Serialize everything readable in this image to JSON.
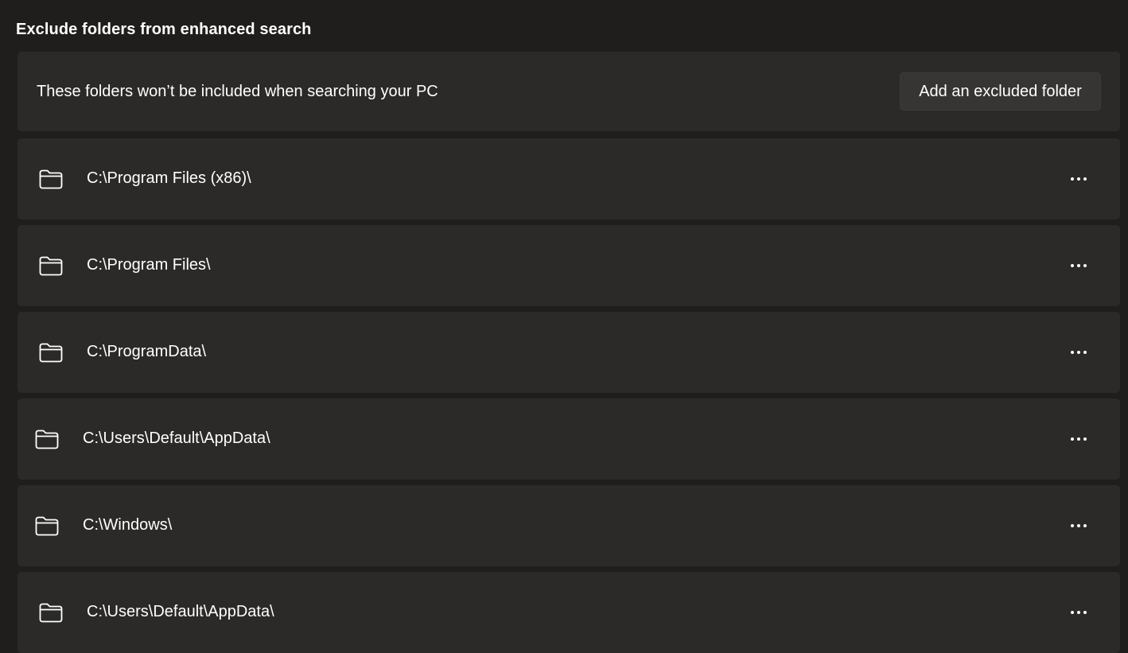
{
  "section": {
    "title": "Exclude folders from enhanced search"
  },
  "header": {
    "description": "These folders won’t be included when searching your PC",
    "add_button_label": "Add an excluded folder"
  },
  "folders": [
    {
      "path": "C:\\Program Files (x86)\\",
      "icon": "folder-icon",
      "more_icon": "more-options-icon"
    },
    {
      "path": "C:\\Program Files\\",
      "icon": "folder-icon",
      "more_icon": "more-options-icon"
    },
    {
      "path": "C:\\ProgramData\\",
      "icon": "folder-icon",
      "more_icon": "more-options-icon"
    },
    {
      "path": "C:\\Users\\Default\\AppData\\",
      "icon": "folder-icon",
      "more_icon": "more-options-icon"
    },
    {
      "path": "C:\\Windows\\",
      "icon": "folder-icon",
      "more_icon": "more-options-icon"
    },
    {
      "path": "C:\\Users\\Default\\AppData\\",
      "icon": "folder-icon",
      "more_icon": "more-options-icon"
    }
  ],
  "colors": {
    "background": "#201e1c",
    "card": "#2b2a29",
    "button": "#373533",
    "text": "#ffffff"
  }
}
